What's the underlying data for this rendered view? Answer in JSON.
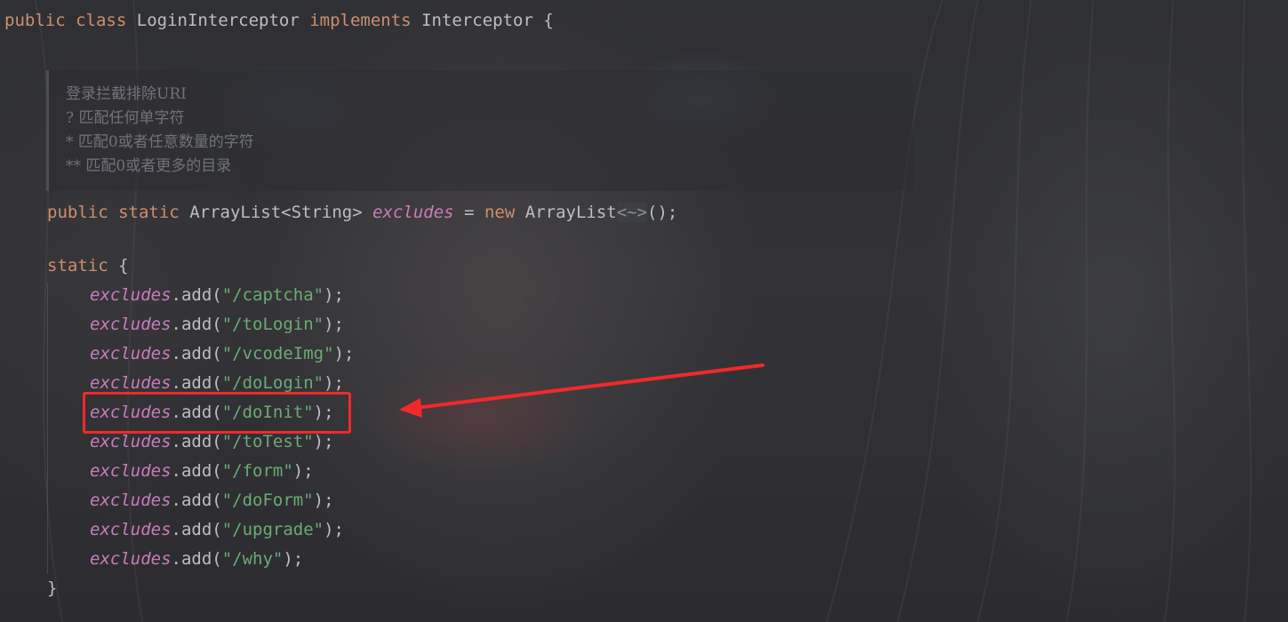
{
  "class_decl": {
    "public": "public",
    "class": "class",
    "name": "LoginInterceptor",
    "implements": "implements",
    "iface": "Interceptor",
    "brace": "{"
  },
  "doc_comment": [
    "登录拦截排除URI",
    "? 匹配任何单字符",
    "* 匹配0或者任意数量的字符",
    "** 匹配0或者更多的目录"
  ],
  "field_decl": {
    "public": "public",
    "static": "static",
    "type": "ArrayList<String>",
    "name": "excludes",
    "eq": "=",
    "new": "new",
    "ctor": "ArrayList",
    "diamond": "<~>",
    "tail": "();"
  },
  "static_block": {
    "keyword": "static",
    "open": "{",
    "close": "}"
  },
  "excludes_calls": [
    {
      "field": "excludes",
      "method": ".add(",
      "arg": "\"/captcha\"",
      "end": ");"
    },
    {
      "field": "excludes",
      "method": ".add(",
      "arg": "\"/toLogin\"",
      "end": ");"
    },
    {
      "field": "excludes",
      "method": ".add(",
      "arg": "\"/vcodeImg\"",
      "end": ");"
    },
    {
      "field": "excludes",
      "method": ".add(",
      "arg": "\"/doLogin\"",
      "end": ");"
    },
    {
      "field": "excludes",
      "method": ".add(",
      "arg": "\"/doInit\"",
      "end": ");"
    },
    {
      "field": "excludes",
      "method": ".add(",
      "arg": "\"/toTest\"",
      "end": ");"
    },
    {
      "field": "excludes",
      "method": ".add(",
      "arg": "\"/form\"",
      "end": ");"
    },
    {
      "field": "excludes",
      "method": ".add(",
      "arg": "\"/doForm\"",
      "end": ");"
    },
    {
      "field": "excludes",
      "method": ".add(",
      "arg": "\"/upgrade\"",
      "end": ");"
    },
    {
      "field": "excludes",
      "method": ".add(",
      "arg": "\"/why\"",
      "end": ");"
    }
  ],
  "annotation": {
    "highlighted_call_index": 4,
    "color": "#f1292a"
  },
  "colors": {
    "keyword": "#cf8e6d",
    "field": "#c77dbb",
    "string": "#6aab73",
    "text": "#bcbec4",
    "comment": "#6f737a"
  }
}
